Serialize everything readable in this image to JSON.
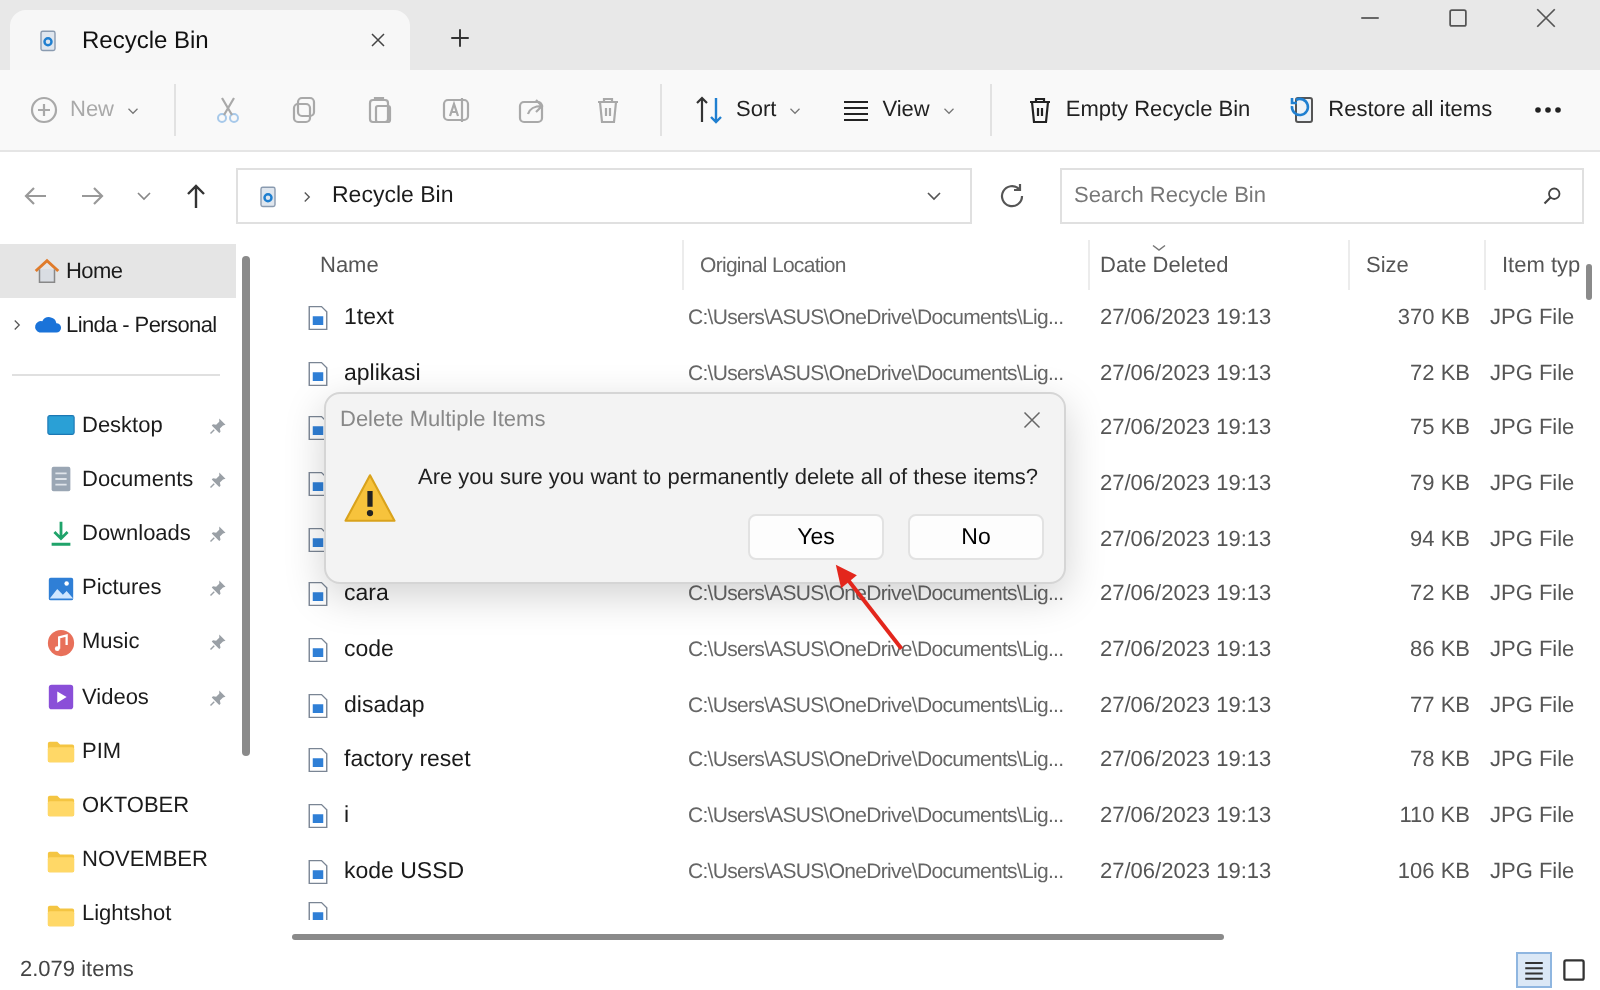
{
  "window": {
    "tab_title": "Recycle Bin"
  },
  "toolbar": {
    "items": [
      {
        "kind": "new",
        "label": "New",
        "disabled": true,
        "dropdown": true
      },
      {
        "kind": "separator"
      },
      {
        "kind": "cut",
        "disabled": true
      },
      {
        "kind": "copy",
        "disabled": true
      },
      {
        "kind": "paste",
        "disabled": true
      },
      {
        "kind": "rename",
        "disabled": true
      },
      {
        "kind": "share",
        "disabled": true
      },
      {
        "kind": "delete",
        "disabled": true
      },
      {
        "kind": "separator"
      },
      {
        "kind": "sort",
        "label": "Sort",
        "disabled": false,
        "dropdown": true
      },
      {
        "kind": "view",
        "label": "View",
        "disabled": false,
        "dropdown": true
      },
      {
        "kind": "separator"
      },
      {
        "kind": "empty",
        "label": "Empty Recycle Bin",
        "disabled": false,
        "dropdown": false
      },
      {
        "kind": "restore",
        "label": "Restore all items",
        "disabled": false,
        "dropdown": false
      },
      {
        "kind": "more",
        "disabled": false
      }
    ]
  },
  "address": {
    "path": "Recycle Bin"
  },
  "search": {
    "placeholder": "Search Recycle Bin"
  },
  "sidebar": {
    "groups": [
      [
        {
          "kind": "home",
          "label": "Home",
          "selected": true,
          "pinned": false,
          "expandable": false
        },
        {
          "kind": "cloud",
          "label": "Linda - Personal",
          "selected": false,
          "pinned": false,
          "expandable": true
        }
      ],
      [
        {
          "kind": "desktop",
          "label": "Desktop",
          "selected": false,
          "pinned": true,
          "expandable": false
        },
        {
          "kind": "documents",
          "label": "Documents",
          "selected": false,
          "pinned": true,
          "expandable": false
        },
        {
          "kind": "downloads",
          "label": "Downloads",
          "selected": false,
          "pinned": true,
          "expandable": false
        },
        {
          "kind": "pictures",
          "label": "Pictures",
          "selected": false,
          "pinned": true,
          "expandable": false
        },
        {
          "kind": "music",
          "label": "Music",
          "selected": false,
          "pinned": true,
          "expandable": false
        },
        {
          "kind": "videos",
          "label": "Videos",
          "selected": false,
          "pinned": true,
          "expandable": false
        },
        {
          "kind": "folder",
          "label": "PIM",
          "selected": false,
          "pinned": false,
          "expandable": false
        },
        {
          "kind": "folder",
          "label": "OKTOBER",
          "selected": false,
          "pinned": false,
          "expandable": false
        },
        {
          "kind": "folder",
          "label": "NOVEMBER",
          "selected": false,
          "pinned": false,
          "expandable": false
        },
        {
          "kind": "folder",
          "label": "Lightshot",
          "selected": false,
          "pinned": false,
          "expandable": false
        }
      ]
    ]
  },
  "table": {
    "columns": [
      {
        "label": "Name",
        "sorted": false
      },
      {
        "label": "Original Location",
        "sorted": false
      },
      {
        "label": "Date Deleted",
        "sorted": true
      },
      {
        "label": "Size",
        "sorted": false
      },
      {
        "label": "Item typ",
        "sorted": false
      }
    ],
    "rows": [
      {
        "name": "1text",
        "location": "C:\\Users\\ASUS\\OneDrive\\Documents\\Lig...",
        "date": "27/06/2023 19:13",
        "size": "370 KB",
        "type": "JPG File"
      },
      {
        "name": "aplikasi",
        "location": "C:\\Users\\ASUS\\OneDrive\\Documents\\Lig...",
        "date": "27/06/2023 19:13",
        "size": "72 KB",
        "type": "JPG File"
      },
      {
        "date": "27/06/2023 19:13",
        "size": "75 KB",
        "type": "JPG File"
      },
      {
        "date": "27/06/2023 19:13",
        "size": "79 KB",
        "type": "JPG File"
      },
      {
        "date": "27/06/2023 19:13",
        "size": "94 KB",
        "type": "JPG File"
      },
      {
        "name": "cara",
        "location": "C:\\Users\\ASUS\\OneDrive\\Documents\\Lig...",
        "date": "27/06/2023 19:13",
        "size": "72 KB",
        "type": "JPG File"
      },
      {
        "name": "code",
        "location": "C:\\Users\\ASUS\\OneDrive\\Documents\\Lig...",
        "date": "27/06/2023 19:13",
        "size": "86 KB",
        "type": "JPG File"
      },
      {
        "name": "disadap",
        "location": "C:\\Users\\ASUS\\OneDrive\\Documents\\Lig...",
        "date": "27/06/2023 19:13",
        "size": "77 KB",
        "type": "JPG File"
      },
      {
        "name": "factory reset",
        "location": "C:\\Users\\ASUS\\OneDrive\\Documents\\Lig...",
        "date": "27/06/2023 19:13",
        "size": "78 KB",
        "type": "JPG File"
      },
      {
        "name": "i",
        "location": "C:\\Users\\ASUS\\OneDrive\\Documents\\Lig...",
        "date": "27/06/2023 19:13",
        "size": "110 KB",
        "type": "JPG File"
      },
      {
        "name": "kode USSD",
        "location": "C:\\Users\\ASUS\\OneDrive\\Documents\\Lig...",
        "date": "27/06/2023 19:13",
        "size": "106 KB",
        "type": "JPG File"
      }
    ]
  },
  "status_bar": {
    "count": "2.079 items",
    "views": [
      {
        "kind": "details",
        "selected": true
      },
      {
        "kind": "tiles",
        "selected": false
      }
    ]
  },
  "dialog": {
    "title": "Delete Multiple Items",
    "message": "Are you sure you want to permanently delete all of these items?",
    "buttons": [
      {
        "label": "Yes"
      },
      {
        "label": "No"
      }
    ]
  }
}
